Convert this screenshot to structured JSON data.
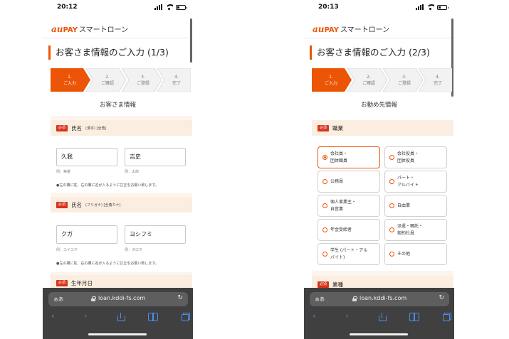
{
  "screens": [
    {
      "time": "20:12",
      "app": {
        "logo_au": "au",
        "logo_pay": "PAY",
        "logo_rest": "スマートローン"
      },
      "page_title": "お客さま情報のご入力 (1/3)",
      "steps": [
        {
          "num": "1.",
          "label": "ご入力"
        },
        {
          "num": "2.",
          "label": "ご確認"
        },
        {
          "num": "3.",
          "label": "ご登録"
        },
        {
          "num": "4.",
          "label": "完了"
        }
      ],
      "active_step": 1,
      "section_title": "お客さま情報",
      "required_badge": "必須",
      "fields": [
        {
          "label": "氏名",
          "note": "(漢字) [全角]",
          "inputs": [
            {
              "value": "久我",
              "example": "例：美雄"
            },
            {
              "value": "吉史",
              "example": "例：太郎"
            }
          ],
          "hint": "●左の欄に姓、右の欄に名が入るように訂正をお願い致します。"
        },
        {
          "label": "氏名",
          "note": "(フリガナ) [全角カナ]",
          "inputs": [
            {
              "value": "クガ",
              "example": "例：エイユウ"
            },
            {
              "value": "ヨシフミ",
              "example": "例：タロウ"
            }
          ],
          "hint": "●左の欄に姓、右の欄に名が入るように訂正をお願い致します。"
        },
        {
          "label": "生年月日"
        }
      ],
      "browser": {
        "aa": "ぁあ",
        "url": "loan.kddi-fs.com",
        "reload": "↻",
        "back": "‹",
        "forward": "›"
      }
    },
    {
      "time": "20:13",
      "app": {
        "logo_au": "au",
        "logo_pay": "PAY",
        "logo_rest": "スマートローン"
      },
      "page_title": "お客さま情報のご入力 (2/3)",
      "steps": [
        {
          "num": "1.",
          "label": "ご入力"
        },
        {
          "num": "2.",
          "label": "ご確認"
        },
        {
          "num": "3.",
          "label": "ご登録"
        },
        {
          "num": "4.",
          "label": "完了"
        }
      ],
      "active_step": 1,
      "section_title": "お勤め先情報",
      "required_badge": "必須",
      "occupation_label": "職業",
      "occupation_options": [
        {
          "line1": "会社員・",
          "line2": "団体職員",
          "selected": true
        },
        {
          "line1": "会社役員・",
          "line2": "団体役員",
          "selected": false
        },
        {
          "line1": "公務員",
          "line2": "",
          "selected": false
        },
        {
          "line1": "パート・",
          "line2": "アルバイト",
          "selected": false
        },
        {
          "line1": "個人事業主・",
          "line2": "自営業",
          "selected": false
        },
        {
          "line1": "自由業",
          "line2": "",
          "selected": false
        },
        {
          "line1": "年金受給者",
          "line2": "",
          "selected": false
        },
        {
          "line1": "派遣・嘱託・",
          "line2": "契約社員",
          "selected": false
        },
        {
          "line1": "学生 (パート・アル",
          "line2": "バイト)",
          "selected": false
        },
        {
          "line1": "その他",
          "line2": "",
          "selected": false
        }
      ],
      "industry_label": "業種",
      "browser": {
        "aa": "ぁあ",
        "url": "loan.kddi-fs.com",
        "reload": "↻",
        "back": "‹",
        "forward": "›"
      }
    }
  ],
  "colors": {
    "accent": "#eb5505",
    "required": "#d7331d",
    "browser_bg": "#404040",
    "link_blue": "#4a8ff0"
  }
}
